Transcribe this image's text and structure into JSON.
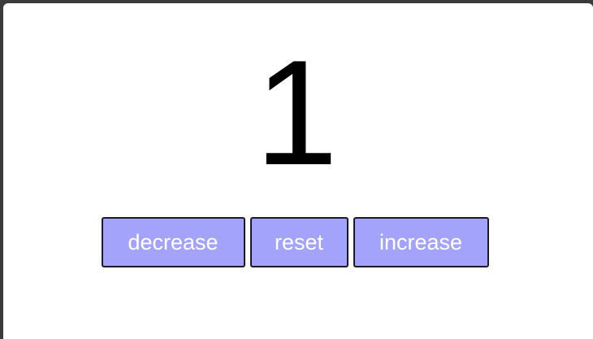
{
  "counter": {
    "value": "1"
  },
  "controls": {
    "decrease_label": "decrease",
    "reset_label": "reset",
    "increase_label": "increase"
  },
  "colors": {
    "button_bg": "#a3a3fb",
    "button_text": "#ffffff",
    "value_text": "#000000"
  }
}
